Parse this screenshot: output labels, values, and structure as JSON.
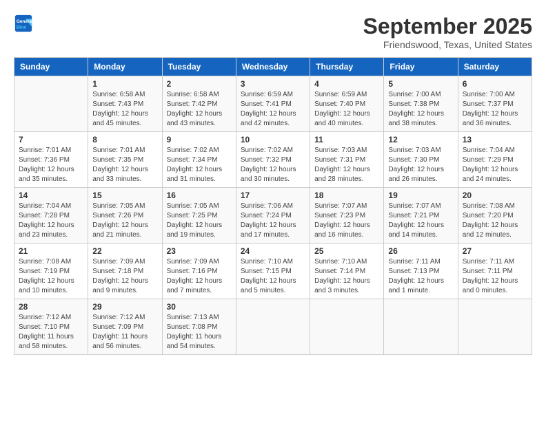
{
  "header": {
    "logo_line1": "General",
    "logo_line2": "Blue",
    "month_title": "September 2025",
    "location": "Friendswood, Texas, United States"
  },
  "days_of_week": [
    "Sunday",
    "Monday",
    "Tuesday",
    "Wednesday",
    "Thursday",
    "Friday",
    "Saturday"
  ],
  "weeks": [
    [
      {
        "day": "",
        "info": ""
      },
      {
        "day": "1",
        "info": "Sunrise: 6:58 AM\nSunset: 7:43 PM\nDaylight: 12 hours\nand 45 minutes."
      },
      {
        "day": "2",
        "info": "Sunrise: 6:58 AM\nSunset: 7:42 PM\nDaylight: 12 hours\nand 43 minutes."
      },
      {
        "day": "3",
        "info": "Sunrise: 6:59 AM\nSunset: 7:41 PM\nDaylight: 12 hours\nand 42 minutes."
      },
      {
        "day": "4",
        "info": "Sunrise: 6:59 AM\nSunset: 7:40 PM\nDaylight: 12 hours\nand 40 minutes."
      },
      {
        "day": "5",
        "info": "Sunrise: 7:00 AM\nSunset: 7:38 PM\nDaylight: 12 hours\nand 38 minutes."
      },
      {
        "day": "6",
        "info": "Sunrise: 7:00 AM\nSunset: 7:37 PM\nDaylight: 12 hours\nand 36 minutes."
      }
    ],
    [
      {
        "day": "7",
        "info": "Sunrise: 7:01 AM\nSunset: 7:36 PM\nDaylight: 12 hours\nand 35 minutes."
      },
      {
        "day": "8",
        "info": "Sunrise: 7:01 AM\nSunset: 7:35 PM\nDaylight: 12 hours\nand 33 minutes."
      },
      {
        "day": "9",
        "info": "Sunrise: 7:02 AM\nSunset: 7:34 PM\nDaylight: 12 hours\nand 31 minutes."
      },
      {
        "day": "10",
        "info": "Sunrise: 7:02 AM\nSunset: 7:32 PM\nDaylight: 12 hours\nand 30 minutes."
      },
      {
        "day": "11",
        "info": "Sunrise: 7:03 AM\nSunset: 7:31 PM\nDaylight: 12 hours\nand 28 minutes."
      },
      {
        "day": "12",
        "info": "Sunrise: 7:03 AM\nSunset: 7:30 PM\nDaylight: 12 hours\nand 26 minutes."
      },
      {
        "day": "13",
        "info": "Sunrise: 7:04 AM\nSunset: 7:29 PM\nDaylight: 12 hours\nand 24 minutes."
      }
    ],
    [
      {
        "day": "14",
        "info": "Sunrise: 7:04 AM\nSunset: 7:28 PM\nDaylight: 12 hours\nand 23 minutes."
      },
      {
        "day": "15",
        "info": "Sunrise: 7:05 AM\nSunset: 7:26 PM\nDaylight: 12 hours\nand 21 minutes."
      },
      {
        "day": "16",
        "info": "Sunrise: 7:05 AM\nSunset: 7:25 PM\nDaylight: 12 hours\nand 19 minutes."
      },
      {
        "day": "17",
        "info": "Sunrise: 7:06 AM\nSunset: 7:24 PM\nDaylight: 12 hours\nand 17 minutes."
      },
      {
        "day": "18",
        "info": "Sunrise: 7:07 AM\nSunset: 7:23 PM\nDaylight: 12 hours\nand 16 minutes."
      },
      {
        "day": "19",
        "info": "Sunrise: 7:07 AM\nSunset: 7:21 PM\nDaylight: 12 hours\nand 14 minutes."
      },
      {
        "day": "20",
        "info": "Sunrise: 7:08 AM\nSunset: 7:20 PM\nDaylight: 12 hours\nand 12 minutes."
      }
    ],
    [
      {
        "day": "21",
        "info": "Sunrise: 7:08 AM\nSunset: 7:19 PM\nDaylight: 12 hours\nand 10 minutes."
      },
      {
        "day": "22",
        "info": "Sunrise: 7:09 AM\nSunset: 7:18 PM\nDaylight: 12 hours\nand 9 minutes."
      },
      {
        "day": "23",
        "info": "Sunrise: 7:09 AM\nSunset: 7:16 PM\nDaylight: 12 hours\nand 7 minutes."
      },
      {
        "day": "24",
        "info": "Sunrise: 7:10 AM\nSunset: 7:15 PM\nDaylight: 12 hours\nand 5 minutes."
      },
      {
        "day": "25",
        "info": "Sunrise: 7:10 AM\nSunset: 7:14 PM\nDaylight: 12 hours\nand 3 minutes."
      },
      {
        "day": "26",
        "info": "Sunrise: 7:11 AM\nSunset: 7:13 PM\nDaylight: 12 hours\nand 1 minute."
      },
      {
        "day": "27",
        "info": "Sunrise: 7:11 AM\nSunset: 7:11 PM\nDaylight: 12 hours\nand 0 minutes."
      }
    ],
    [
      {
        "day": "28",
        "info": "Sunrise: 7:12 AM\nSunset: 7:10 PM\nDaylight: 11 hours\nand 58 minutes."
      },
      {
        "day": "29",
        "info": "Sunrise: 7:12 AM\nSunset: 7:09 PM\nDaylight: 11 hours\nand 56 minutes."
      },
      {
        "day": "30",
        "info": "Sunrise: 7:13 AM\nSunset: 7:08 PM\nDaylight: 11 hours\nand 54 minutes."
      },
      {
        "day": "",
        "info": ""
      },
      {
        "day": "",
        "info": ""
      },
      {
        "day": "",
        "info": ""
      },
      {
        "day": "",
        "info": ""
      }
    ]
  ]
}
